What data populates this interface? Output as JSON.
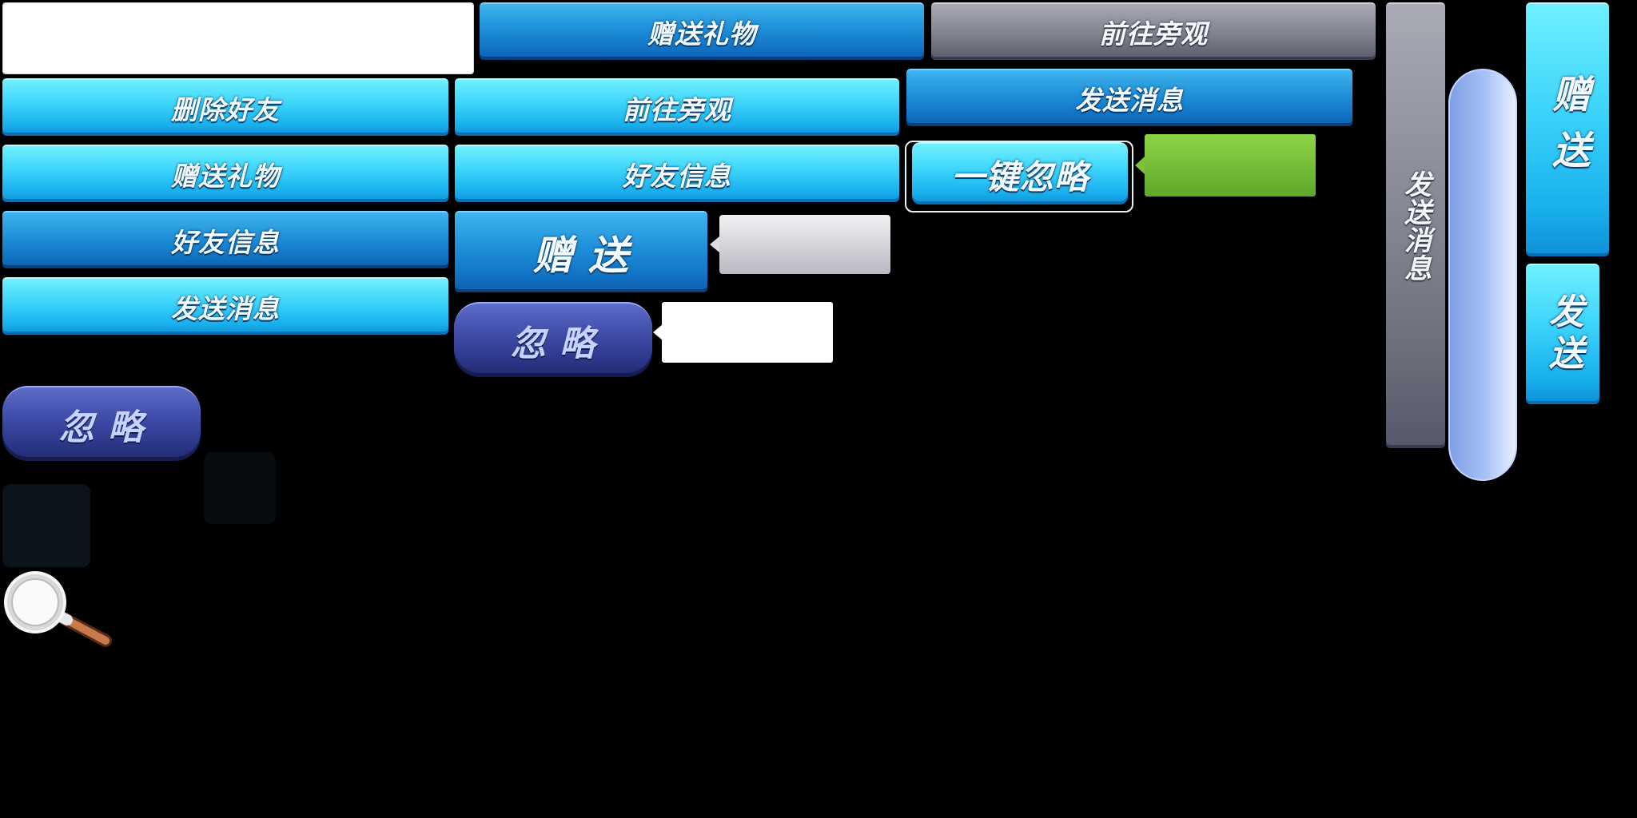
{
  "col_a": {
    "delete_friend": "删除好友",
    "send_gift": "赠送礼物",
    "friend_info": "好友信息",
    "send_message": "发送消息"
  },
  "col_b": {
    "spectate": "前往旁观",
    "friend_info": "好友信息",
    "gift_short": "赠 送",
    "ignore": "忽 略"
  },
  "top_row": {
    "send_gift": "赠送礼物",
    "spectate": "前往旁观"
  },
  "col_c": {
    "send_message": "发送消息",
    "ignore_all": "一键忽略"
  },
  "left": {
    "ignore": "忽 略"
  },
  "vertical": {
    "send_message": "发送消息",
    "gift": "赠送",
    "send": "发送"
  },
  "icons": {
    "magnifier": "magnifier-icon"
  }
}
